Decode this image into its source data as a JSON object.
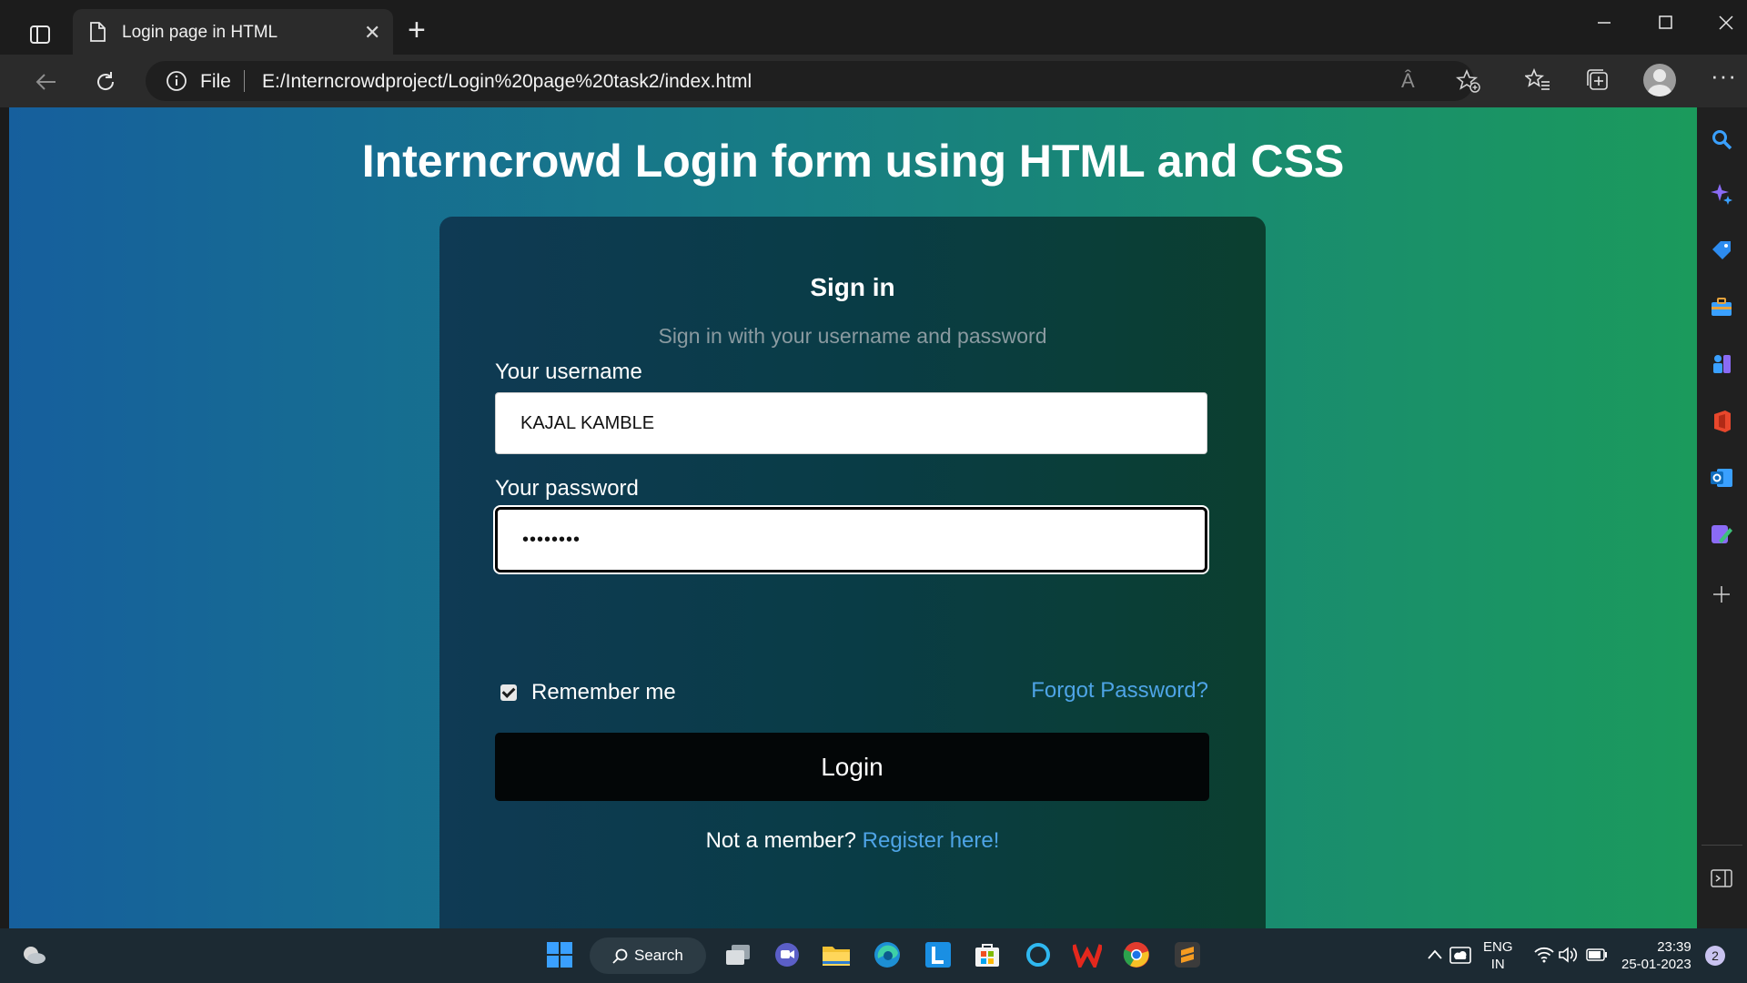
{
  "browser": {
    "tab_title": "Login page in HTML",
    "url_scheme_label": "File",
    "url": "E:/Interncrowdproject/Login%20page%20task2/index.html",
    "read_aloud_label": "Â"
  },
  "page": {
    "heading": "Interncrowd Login form using HTML and CSS",
    "card_title": "Sign in",
    "card_subtitle": "Sign in with your username and password",
    "username_label": "Your username",
    "username_value": "KAJAL KAMBLE",
    "password_label": "Your password",
    "password_value": "••••••••",
    "remember_label": "Remember me",
    "remember_checked": true,
    "forgot_link": "Forgot Password?",
    "login_button": "Login",
    "register_prompt": "Not a member?",
    "register_link": "Register here!"
  },
  "taskbar": {
    "search_label": "Search",
    "language_line1": "ENG",
    "language_line2": "IN",
    "time": "23:39",
    "date": "25-01-2023",
    "notification_count": "2"
  },
  "colors": {
    "gradient_left": "#165f9d",
    "gradient_right": "#1b9a5c",
    "link": "#4ea4e6",
    "button": "#030607"
  }
}
